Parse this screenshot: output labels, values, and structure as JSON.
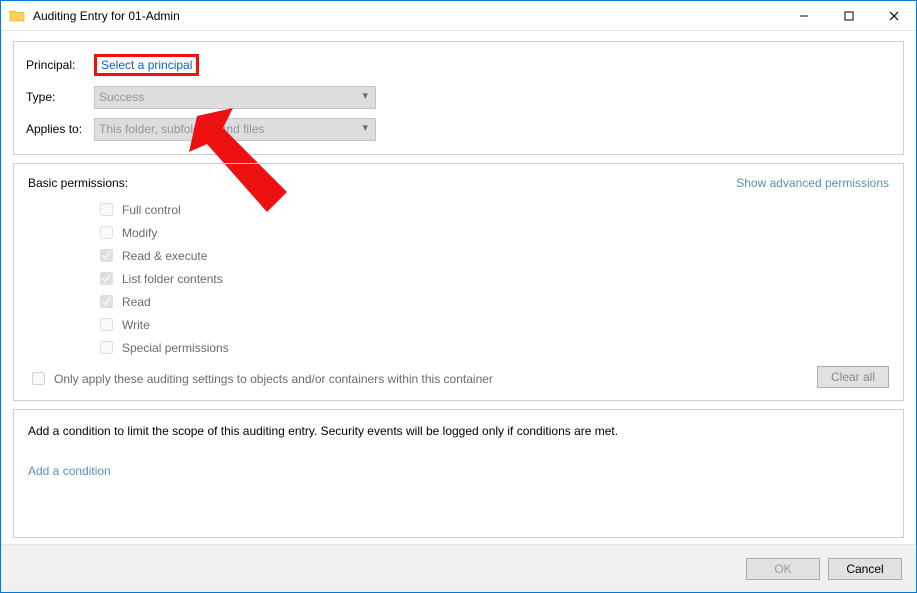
{
  "title": "Auditing Entry for 01-Admin",
  "labels": {
    "principal": "Principal:",
    "type": "Type:",
    "applies": "Applies to:"
  },
  "principal_link": "Select a principal",
  "type_value": "Success",
  "applies_value": "This folder, subfolders and files",
  "permissions_header": "Basic permissions:",
  "advanced_link": "Show advanced permissions",
  "permissions": [
    {
      "label": "Full control",
      "checked": false
    },
    {
      "label": "Modify",
      "checked": false
    },
    {
      "label": "Read & execute",
      "checked": true
    },
    {
      "label": "List folder contents",
      "checked": true
    },
    {
      "label": "Read",
      "checked": true
    },
    {
      "label": "Write",
      "checked": false
    },
    {
      "label": "Special permissions",
      "checked": false
    }
  ],
  "only_apply": "Only apply these auditing settings to objects and/or containers within this container",
  "clear_all": "Clear all",
  "condition_desc": "Add a condition to limit the scope of this auditing entry. Security events will be logged only if conditions are met.",
  "add_condition": "Add a condition",
  "buttons": {
    "ok": "OK",
    "cancel": "Cancel"
  }
}
